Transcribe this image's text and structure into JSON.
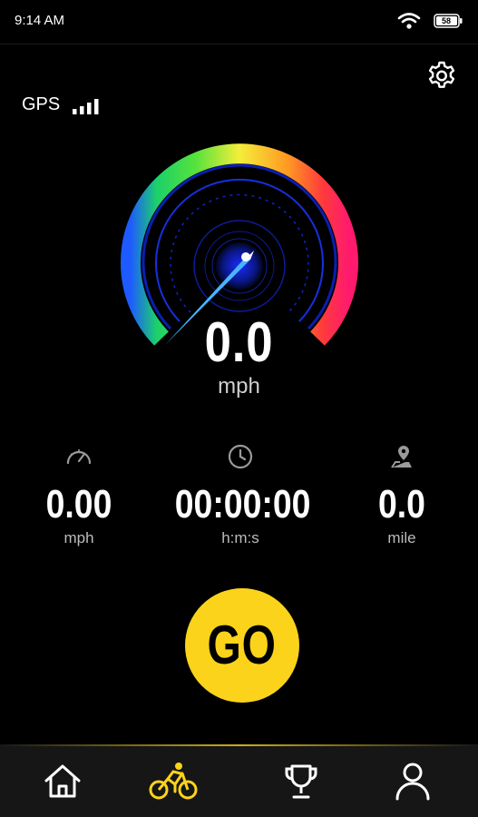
{
  "status_bar": {
    "time": "9:14 AM",
    "battery": "58"
  },
  "gps": {
    "label": "GPS"
  },
  "speedometer": {
    "speed": "0.0",
    "unit": "mph"
  },
  "stats": [
    {
      "icon": "gauge-icon",
      "value": "0.00",
      "unit": "mph"
    },
    {
      "icon": "clock-icon",
      "value": "00:00:00",
      "unit": "h:m:s"
    },
    {
      "icon": "location-pin-icon",
      "value": "0.0",
      "unit": "mile"
    }
  ],
  "go_button": {
    "label": "GO"
  },
  "tab_bar": {
    "items": [
      {
        "icon": "home-icon",
        "active": false
      },
      {
        "icon": "bicycle-icon",
        "active": true
      },
      {
        "icon": "trophy-icon",
        "active": false
      },
      {
        "icon": "profile-icon",
        "active": false
      }
    ]
  },
  "colors": {
    "accent": "#fbd31a",
    "background": "#000000",
    "tabbar": "#161616"
  }
}
